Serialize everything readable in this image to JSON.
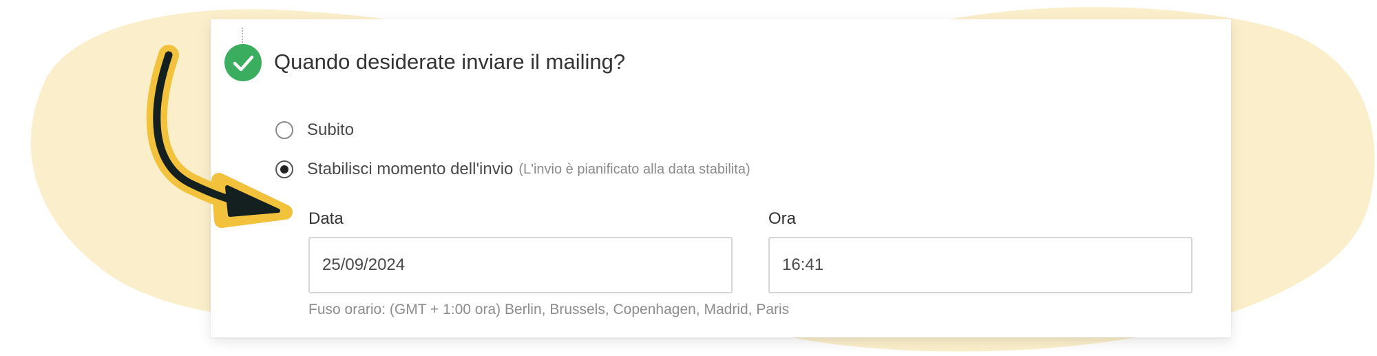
{
  "colors": {
    "background_blob": "#fbefcb",
    "arrow_fill": "#f2c23c",
    "arrow_stroke": "#13201f",
    "success_green": "#3aad5e"
  },
  "step": {
    "status_icon": "check-circle-icon",
    "title": "Quando desiderate inviare il mailing?"
  },
  "options": [
    {
      "label": "Subito",
      "hint": "",
      "checked": false
    },
    {
      "label": "Stabilisci momento dell'invio",
      "hint": "(L'invio è pianificato alla data stabilita)",
      "checked": true
    }
  ],
  "schedule": {
    "date_label": "Data",
    "date_value": "25/09/2024",
    "time_label": "Ora",
    "time_value": "16:41",
    "timezone": "Fuso orario: (GMT + 1:00 ora) Berlin, Brussels, Copenhagen, Madrid, Paris"
  },
  "annotation": {
    "icon": "curved-arrow-icon"
  }
}
